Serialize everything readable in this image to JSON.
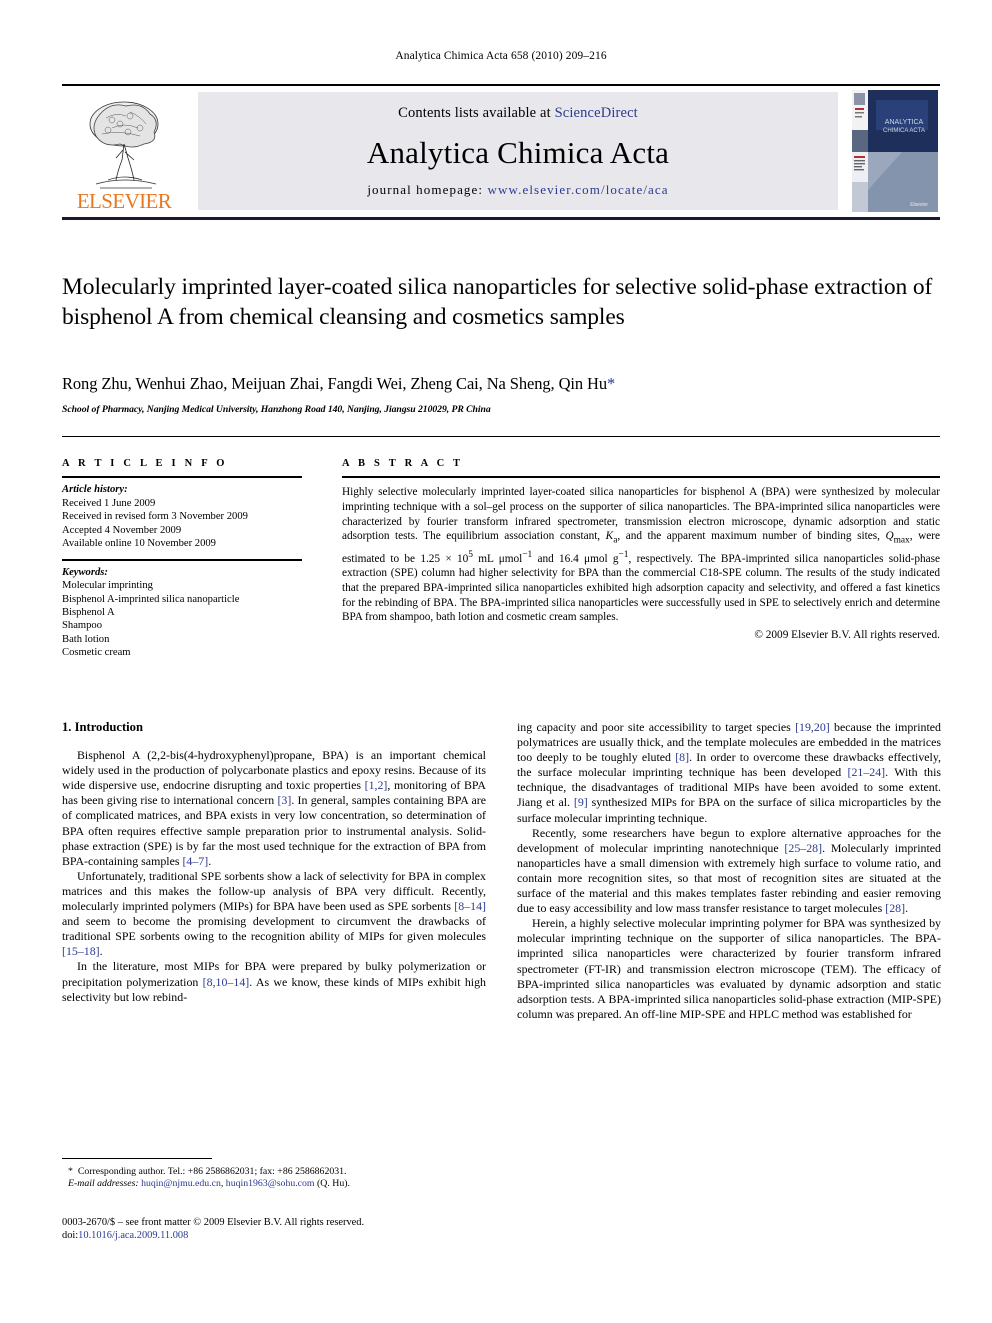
{
  "running_head": "Analytica Chimica Acta 658 (2010) 209–216",
  "masthead": {
    "contents_prefix": "Contents lists available at ",
    "sciencedirect": "ScienceDirect",
    "journal_title": "Analytica Chimica Acta",
    "homepage_prefix": "journal homepage: ",
    "homepage_url": "www.elsevier.com/locate/aca",
    "publisher": "ELSEVIER",
    "cover_title_line1": "ANALYTICA",
    "cover_title_line2": "CHIMICA ACTA",
    "accent_orange": "#E87722",
    "link_blue": "#2b3a8f"
  },
  "article": {
    "title": "Molecularly imprinted layer-coated silica nanoparticles for selective solid-phase extraction of bisphenol A from chemical cleansing and cosmetics samples",
    "authors": "Rong Zhu, Wenhui Zhao, Meijuan Zhai, Fangdi Wei, Zheng Cai, Na Sheng, Qin Hu",
    "corresponding_marker": "*",
    "affiliation": "School of Pharmacy, Nanjing Medical University, Hanzhong Road 140, Nanjing, Jiangsu 210029, PR China"
  },
  "article_info": {
    "heading": "A R T I C L E    I N F O",
    "history_label": "Article history:",
    "history": [
      "Received 1 June 2009",
      "Received in revised form 3 November 2009",
      "Accepted 4 November 2009",
      "Available online 10 November 2009"
    ],
    "keywords_label": "Keywords:",
    "keywords": [
      "Molecular imprinting",
      "Bisphenol A-imprinted silica nanoparticle",
      "Bisphenol A",
      "Shampoo",
      "Bath lotion",
      "Cosmetic cream"
    ]
  },
  "abstract": {
    "heading": "A B S T R A C T",
    "part1": "Highly selective molecularly imprinted layer-coated silica nanoparticles for bisphenol A (BPA) were synthesized by molecular imprinting technique with a sol–gel process on the supporter of silica nanoparticles. The BPA-imprinted silica nanoparticles were characterized by fourier transform infrared spectrometer, transmission electron microscope, dynamic adsorption and static adsorption tests. The equilibrium association constant, ",
    "ka": "K",
    "ka_sub": "a",
    "part2": ", and the apparent maximum number of binding sites, ",
    "qmax": "Q",
    "qmax_sub": "max",
    "part3": ", were estimated to be 1.25 × 10",
    "exp1": "5",
    "part4": " mL μmol",
    "exp2": "−1",
    "part5": " and 16.4 μmol g",
    "exp3": "−1",
    "part6": ", respectively. The BPA-imprinted silica nanoparticles solid-phase extraction (SPE) column had higher selectivity for BPA than the commercial C18-SPE column. The results of the study indicated that the prepared BPA-imprinted silica nanoparticles exhibited high adsorption capacity and selectivity, and offered a fast kinetics for the rebinding of BPA. The BPA-imprinted silica nanoparticles were successfully used in SPE to selectively enrich and determine BPA from shampoo, bath lotion and cosmetic cream samples.",
    "copyright": "© 2009 Elsevier B.V. All rights reserved."
  },
  "introduction": {
    "heading": "1.  Introduction",
    "left_paragraphs": [
      {
        "segments": [
          {
            "t": "Bisphenol A (2,2-bis(4-hydroxyphenyl)propane, BPA) is an important chemical widely used in the production of polycarbonate plastics and epoxy resins. Because of its wide dispersive use, endocrine disrupting and toxic properties "
          },
          {
            "t": "[1,2]",
            "cite": true
          },
          {
            "t": ", monitoring of BPA has been giving rise to international concern "
          },
          {
            "t": "[3]",
            "cite": true
          },
          {
            "t": ". In general, samples containing BPA are of complicated matrices, and BPA exists in very low concentration, so determination of BPA often requires effective sample preparation prior to instrumental analysis. Solid-phase extraction (SPE) is by far the most used technique for the extraction of BPA from BPA-containing samples "
          },
          {
            "t": "[4–7]",
            "cite": true
          },
          {
            "t": "."
          }
        ]
      },
      {
        "segments": [
          {
            "t": "Unfortunately, traditional SPE sorbents show a lack of selectivity for BPA in complex matrices and this makes the follow-up analysis of BPA very difficult. Recently, molecularly imprinted polymers (MIPs) for BPA have been used as SPE sorbents "
          },
          {
            "t": "[8–14]",
            "cite": true
          },
          {
            "t": " and seem to become the promising development to circumvent the drawbacks of traditional SPE sorbents owing to the recognition ability of MIPs for given molecules "
          },
          {
            "t": "[15–18]",
            "cite": true
          },
          {
            "t": "."
          }
        ]
      },
      {
        "segments": [
          {
            "t": "In the literature, most MIPs for BPA were prepared by bulky polymerization or precipitation polymerization "
          },
          {
            "t": "[8,10–14]",
            "cite": true
          },
          {
            "t": ". As we know, these kinds of MIPs exhibit high selectivity but low rebind-"
          }
        ]
      }
    ],
    "right_paragraphs": [
      {
        "noindent": true,
        "segments": [
          {
            "t": "ing capacity and poor site accessibility to target species "
          },
          {
            "t": "[19,20]",
            "cite": true
          },
          {
            "t": " because the imprinted polymatrices are usually thick, and the template molecules are embedded in the matrices too deeply to be toughly eluted "
          },
          {
            "t": "[8]",
            "cite": true
          },
          {
            "t": ". In order to overcome these drawbacks effectively, the surface molecular imprinting technique has been developed "
          },
          {
            "t": "[21–24]",
            "cite": true
          },
          {
            "t": ". With this technique, the disadvantages of traditional MIPs have been avoided to some extent. Jiang et al. "
          },
          {
            "t": "[9]",
            "cite": true
          },
          {
            "t": " synthesized MIPs for BPA on the surface of silica microparticles by the surface molecular imprinting technique."
          }
        ]
      },
      {
        "segments": [
          {
            "t": "Recently, some researchers have begun to explore alternative approaches for the development of molecular imprinting nanotechnique "
          },
          {
            "t": "[25–28]",
            "cite": true
          },
          {
            "t": ". Molecularly imprinted nanoparticles have a small dimension with extremely high surface to volume ratio, and contain more recognition sites, so that most of recognition sites are situated at the surface of the material and this makes templates faster rebinding and easier removing due to easy accessibility and low mass transfer resistance to target molecules "
          },
          {
            "t": "[28]",
            "cite": true
          },
          {
            "t": "."
          }
        ]
      },
      {
        "segments": [
          {
            "t": "Herein, a highly selective molecular imprinting polymer for BPA was synthesized by molecular imprinting technique on the supporter of silica nanoparticles. The BPA-imprinted silica nanoparticles were characterized by fourier transform infrared spectrometer (FT-IR) and transmission electron microscope (TEM). The efficacy of BPA-imprinted silica nanoparticles was evaluated by dynamic adsorption and static adsorption tests. A BPA-imprinted silica nanoparticles solid-phase extraction (MIP-SPE) column was prepared. An off-line MIP-SPE and HPLC method was established for"
          }
        ]
      }
    ]
  },
  "footnote": {
    "marker": "*",
    "corresponding": "Corresponding author. Tel.: +86 2586862031; fax: +86 2586862031.",
    "email_label": "E-mail addresses:",
    "email1": "huqin@njmu.edu.cn",
    "email_sep": ", ",
    "email2": "huqin1963@sohu.com",
    "email_suffix": " (Q. Hu)."
  },
  "issn": {
    "line1": "0003-2670/$ – see front matter © 2009 Elsevier B.V. All rights reserved.",
    "doi_label": "doi:",
    "doi_value": "10.1016/j.aca.2009.11.008"
  }
}
